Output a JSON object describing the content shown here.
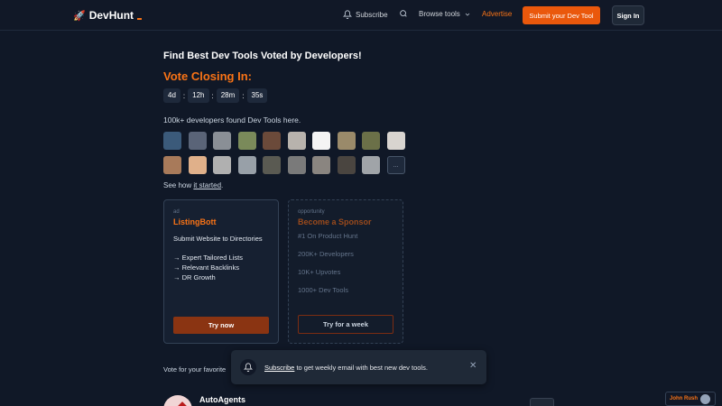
{
  "nav": {
    "logo": "DevHunt",
    "subscribe": "Subscribe",
    "browse": "Browse tools",
    "advertise": "Advertise",
    "submit": "Submit your Dev Tool",
    "signin": "Sign In"
  },
  "hero": {
    "title": "Find Best Dev Tools Voted by Developers!",
    "closing": "Vote Closing In:",
    "timer": {
      "d": "4d",
      "h": "12h",
      "m": "28m",
      "s": "35s"
    },
    "found": "100k+ developers found Dev Tools here.",
    "see_how_prefix": "See how ",
    "see_how_link": "it started",
    "see_how_suffix": "."
  },
  "avatars": [
    "#3b5a7a",
    "#5a6478",
    "#8a8f96",
    "#7a8a5a",
    "#6b4a3a",
    "#b8b3ad",
    "#f4f4f4",
    "#9a8a6a",
    "#6b7048",
    "#d8d4d0",
    "#a87a5a",
    "#e0b08a",
    "#b0b0b0",
    "#98a0a8",
    "#5a5a52",
    "#7a7a7a",
    "#8a8580",
    "#4a4540",
    "#a0a4a8"
  ],
  "more_label": "...",
  "ad_card": {
    "tag": "ad",
    "title": "ListingBott",
    "desc": "Submit Website to Directories",
    "points": [
      "→ Expert Tailored Lists",
      "→ Relevant Backlinks",
      "→ DR Growth"
    ],
    "button": "Try now"
  },
  "sponsor_card": {
    "tag": "opportunity",
    "title": "Become a Sponsor",
    "points": [
      "#1 On Product Hunt",
      "200K+ Developers",
      "10K+ Upvotes",
      "1000+ Dev Tools"
    ],
    "button": "Try for a week"
  },
  "vote_text": "Vote for your favorite",
  "toast": {
    "link": "Subscribe",
    "text": " to get weekly email with best new dev tools."
  },
  "product": {
    "name": "AutoAgents"
  },
  "badge": {
    "name": "John Rush"
  }
}
